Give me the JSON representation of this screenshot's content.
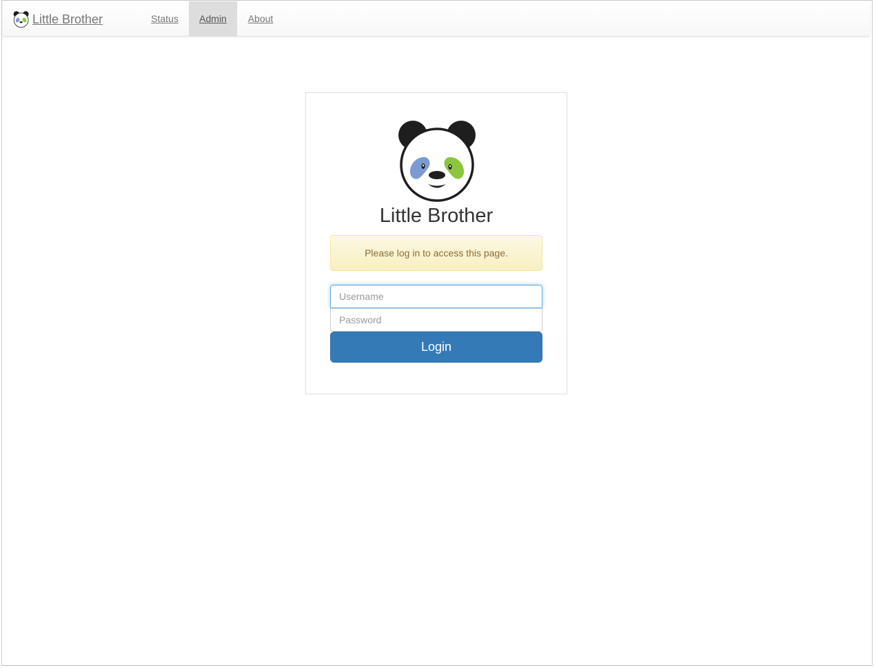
{
  "navbar": {
    "brand_label": " Little Brother",
    "items": [
      {
        "label": "Status",
        "active": false
      },
      {
        "label": "Admin",
        "active": true
      },
      {
        "label": "About",
        "active": false
      }
    ]
  },
  "login": {
    "title": "Little Brother",
    "alert_text": "Please log in to access this page.",
    "username_placeholder": "Username",
    "password_placeholder": "Password",
    "button_label": "Login"
  },
  "icons": {
    "brand": "panda-logo-icon",
    "logo": "panda-logo-icon"
  },
  "colors": {
    "primary": "#337ab7",
    "alert_bg": "#fcf8e3",
    "alert_text": "#8a6d3b",
    "panda_blue_eye": "#7b9bd2",
    "panda_green_eye": "#8cc63f",
    "active_nav_bg": "#dddddd"
  }
}
